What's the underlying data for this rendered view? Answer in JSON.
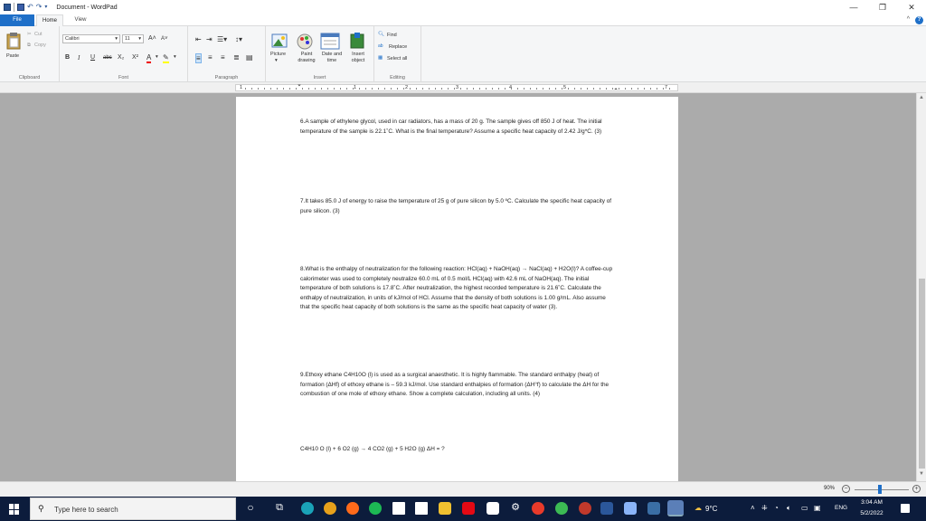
{
  "window": {
    "title": "Document - WordPad"
  },
  "tabs": [
    {
      "label": "File"
    },
    {
      "label": "Home"
    },
    {
      "label": "View"
    }
  ],
  "ribbon": {
    "clipboard": {
      "paste": "Paste",
      "cut": "Cut",
      "copy": "Copy",
      "group_label": "Clipboard"
    },
    "font": {
      "family": "Calibri",
      "size": "11",
      "group_label": "Font",
      "bold": "B",
      "italic": "I",
      "underline": "U",
      "strike": "abc",
      "subscript": "X₂",
      "superscript": "X²"
    },
    "paragraph": {
      "group_label": "Paragraph"
    },
    "insert": {
      "picture": "Picture",
      "paint": "Paint drawing",
      "datetime": "Date and time",
      "object": "Insert object",
      "group_label": "Insert"
    },
    "editing": {
      "find": "Find",
      "replace": "Replace",
      "select_all": "Select all",
      "group_label": "Editing"
    }
  },
  "ruler": {
    "numbers": [
      "1",
      "1",
      "2",
      "3",
      "4",
      "5",
      "7"
    ]
  },
  "document": {
    "paragraphs": [
      "6.A sample of ethylene glycol, used in car radiators, has a mass of 20 g. The sample gives off 850 J of heat. The initial temperature of the sample is 22.1˚C. What is the final temperature? Assume a specific heat capacity of 2.42 J/g*C. (3)",
      "7.It takes 85.0 J of energy to raise the temperature of 25 g of pure silicon by 5.0 ºC. Calculate the specific heat capacity of pure silicon. (3)",
      "8.What is the enthalpy of neutralization for the following reaction: HCl(aq) + NaOH(aq) → NaCl(aq) + H2O(l)? A coffee-cup calorimeter was used to completely neutralize 60.0 mL of 0.5 mol/L HCl(aq) with 42.6 mL of NaOH(aq). The initial temperature of both solutions is 17.8˚C. After neutralization, the highest recorded temperature is 21.6˚C. Calculate the enthalpy of neutralization, in units of kJ/mol of HCl. Assume that the density of both solutions is 1.00 g/mL. Also assume that the specific heat capacity of both solutions is the same as the specific heat capacity of water (3).",
      "9.Ethoxy ethane C4H10O (l) is used as a surgical anaesthetic. It is highly flammable. The standard enthalpy (heat) of formation (ΔHf) of ethoxy ethane is – 59.3 kJ/mol. Use standard enthalpies of formation (ΔH°f) to calculate the ΔH for the combustion of one mole of ethoxy ethane. Show a complete calculation, including all units. (4)",
      "C4H10 O (l) + 6 O2 (g) → 4 CO2 (g) + 5 H2O (g) ΔH = ?"
    ]
  },
  "status": {
    "zoom": "90%"
  },
  "taskbar": {
    "search_placeholder": "Type here to search",
    "weather": "9°C",
    "language": "ENG",
    "time": "3:04 AM",
    "date": "5/2/2022"
  },
  "colors": {
    "accent": "#1e6fc8",
    "taskbar": "#0c1c3c",
    "canvas": "#ababab"
  }
}
